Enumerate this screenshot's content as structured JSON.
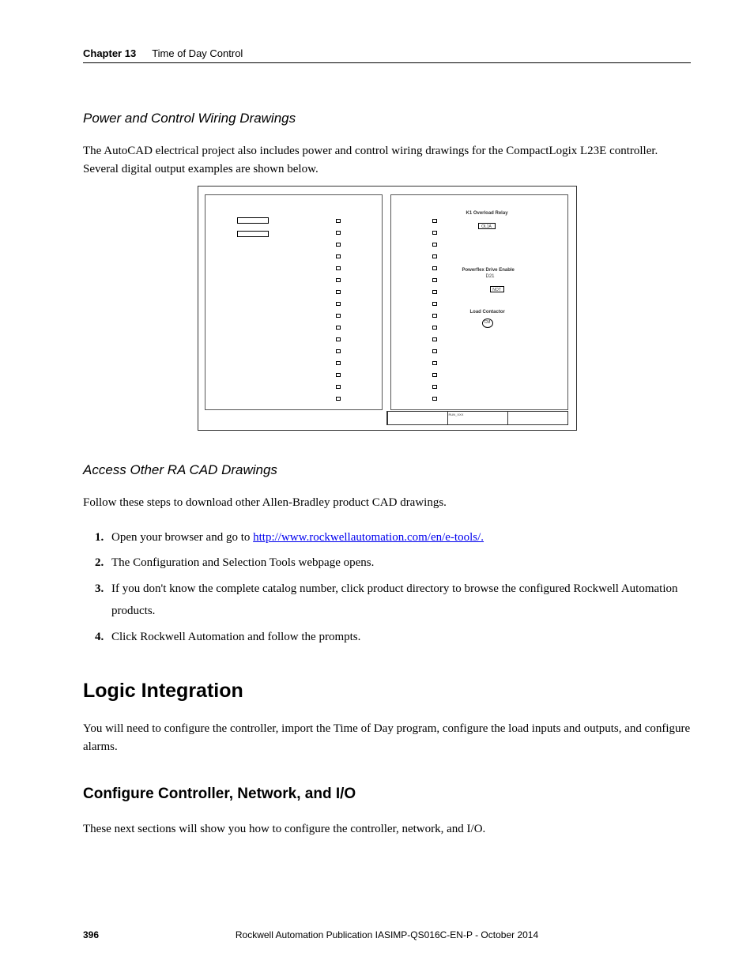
{
  "header": {
    "chapter": "Chapter 13",
    "title": "Time of Day Control"
  },
  "section1": {
    "heading": "Power and Control Wiring Drawings",
    "para": "The AutoCAD electrical project also includes power and control wiring drawings for the CompactLogix L23E controller. Several digital output examples are shown below."
  },
  "diagram": {
    "labels": {
      "overload": "K1 Overload Relay",
      "ol1a": "OL1A",
      "pf_enable": "Powerflex Drive Enable",
      "d21": "D21",
      "not": "NOT",
      "contactor": "Load Contactor",
      "cm": "CM"
    },
    "titleblock": {
      "c1": "",
      "c2": "RUN_XXX",
      "c3": ""
    }
  },
  "section2": {
    "heading": "Access Other RA CAD Drawings",
    "para": "Follow these steps to download other Allen-Bradley product CAD drawings.",
    "steps": [
      {
        "pre": "Open your browser and go to ",
        "link": "http://www.rockwellautomation.com/en/e-tools/."
      },
      {
        "text": "The Configuration and Selection Tools webpage opens."
      },
      {
        "text": "If you don't know the complete catalog number, click product directory to browse the configured Rockwell Automation products."
      },
      {
        "text": "Click Rockwell Automation and follow the prompts."
      }
    ]
  },
  "section3": {
    "heading": "Logic Integration",
    "para": "You will need to configure the controller, import the Time of Day program, configure the load inputs and outputs, and configure alarms."
  },
  "section4": {
    "heading": "Configure Controller, Network, and I/O",
    "para": "These next sections will show you how to configure the controller, network, and I/O."
  },
  "footer": {
    "page": "396",
    "pub": "Rockwell Automation Publication IASIMP-QS016C-EN-P - October 2014"
  }
}
